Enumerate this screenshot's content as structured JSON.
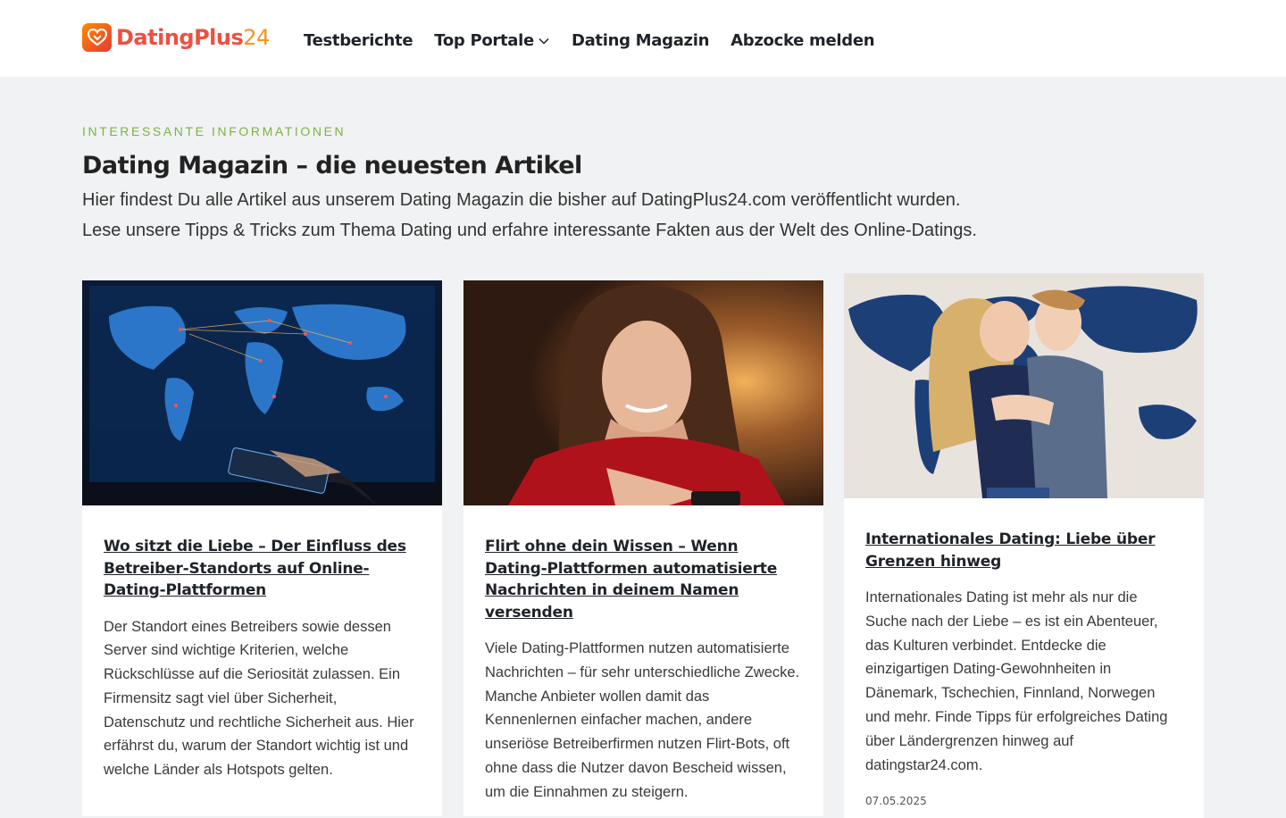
{
  "header": {
    "logo": {
      "part1": "Dating",
      "part2": "Plus",
      "part3": "24"
    },
    "nav": [
      {
        "label": "Testberichte"
      },
      {
        "label": "Top Portale"
      },
      {
        "label": "Dating Magazin"
      },
      {
        "label": "Abzocke melden"
      }
    ]
  },
  "hero": {
    "eyebrow": "Interessante Informationen",
    "title": "Dating Magazin – die neuesten Artikel",
    "intro_line1": "Hier findest Du alle Artikel aus unserem Dating Magazin die bisher auf DatingPlus24.com veröffentlicht wurden.",
    "intro_line2": "Lese unsere Tipps & Tricks zum Thema Dating und erfahre interessante Fakten aus der Welt des Online-Datings."
  },
  "articles": [
    {
      "title": "Wo sitzt die Liebe – Der Einfluss des Betreiber-Standorts auf Online-Dating-Plattformen",
      "excerpt": "Der Standort eines Betreibers sowie dessen Server sind wichtige Kriterien, welche Rückschlüsse auf die Seriosität zulassen. Ein Firmensitz sagt viel über Sicherheit, Datenschutz und rechtliche Sicherheit aus. Hier erfährst du, warum der Standort wichtig ist und welche Länder als Hotspots gelten.",
      "date": ""
    },
    {
      "title": "Flirt ohne dein Wissen – Wenn Dating-Plattformen automatisierte Nachrichten in deinem Namen versenden",
      "excerpt": "Viele Dating-Plattformen nutzen automatisierte Nachrichten – für sehr unterschiedliche Zwecke. Manche Anbieter wollen damit das Kennenlernen einfacher machen, andere unseriöse Betreiberfirmen nutzen Flirt-Bots, oft ohne dass die Nutzer davon Bescheid wissen, um die Einnahmen zu steigern.",
      "date": ""
    },
    {
      "title": "Internationales Dating: Liebe über Grenzen hinweg",
      "excerpt": "Internationales Dating ist mehr als nur die Suche nach der Liebe – es ist ein Abenteuer, das Kulturen verbindet. Entdecke die einzigartigen Dating-Gewohnheiten in Dänemark, Tschechien, Finnland, Norwegen und mehr. Finde Tipps für erfolgreiches Dating über Ländergrenzen hinweg auf datingstar24.com.",
      "date": "07.05.2025"
    }
  ]
}
